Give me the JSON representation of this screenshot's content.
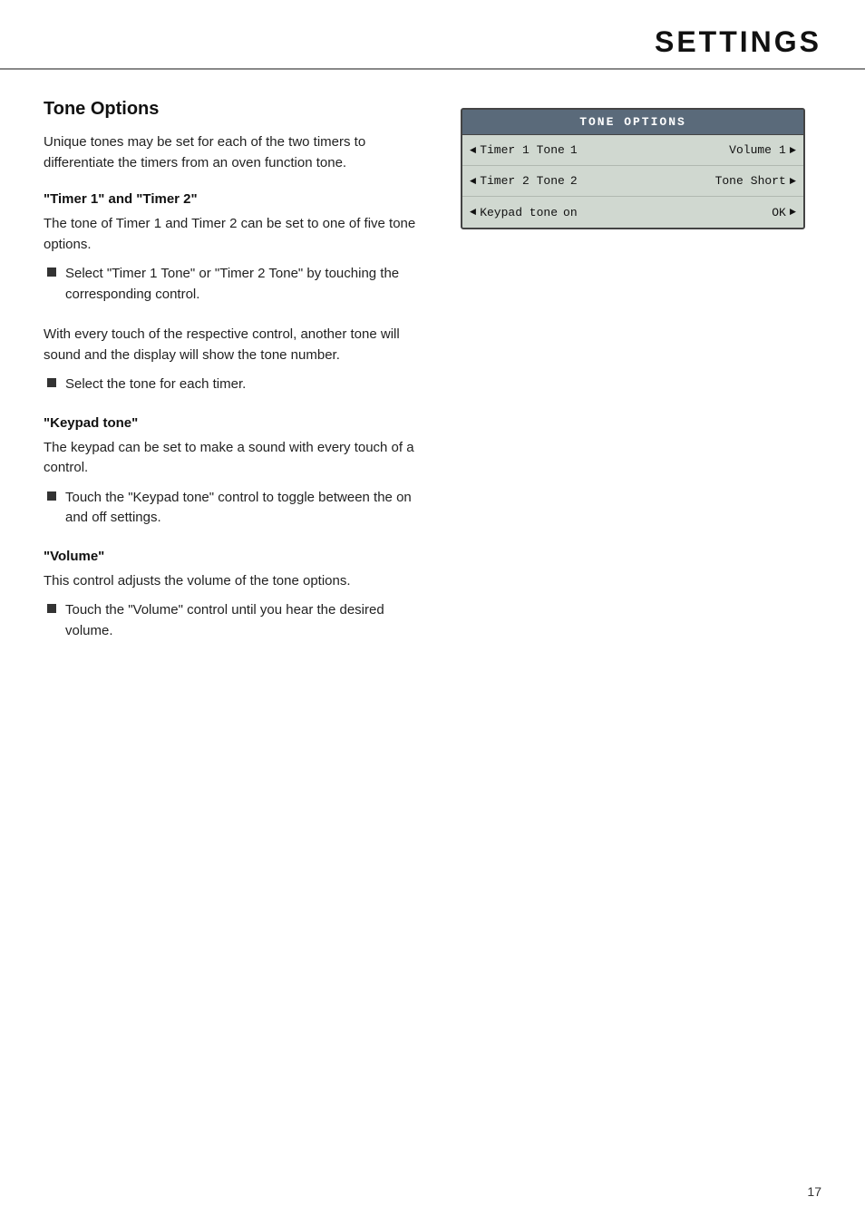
{
  "header": {
    "title": "SETTINGS"
  },
  "page_number": "17",
  "left": {
    "section_title": "Tone Options",
    "intro": "Unique tones may be set for each of the two timers to differentiate the timers from an oven function tone.",
    "subsections": [
      {
        "id": "timer-subsection",
        "title": "\"Timer 1\" and \"Timer 2\"",
        "body": "The tone of Timer 1 and Timer 2 can be set to one of five tone options.",
        "bullets": [
          "Select \"Timer 1 Tone\" or \"Timer 2 Tone\" by touching the corresponding control."
        ]
      },
      {
        "id": "touch-paragraph",
        "title": "",
        "body": "With every touch of the respective control, another tone will sound and the display will show the tone number.",
        "bullets": [
          "Select the tone for each timer."
        ]
      },
      {
        "id": "keypad-subsection",
        "title": "\"Keypad tone\"",
        "body": "The keypad can be set to make a sound with every touch of a control.",
        "bullets": [
          "Touch the \"Keypad tone\" control to toggle between the on and off settings."
        ]
      },
      {
        "id": "volume-subsection",
        "title": "\"Volume\"",
        "body": "This control adjusts the volume of the tone options.",
        "bullets": [
          "Touch the \"Volume\" control until you hear the desired volume."
        ]
      }
    ]
  },
  "display": {
    "header": "TONE OPTIONS",
    "rows": [
      {
        "id": "timer1-row",
        "arrow_left": "◄",
        "label": "Timer 1 Tone",
        "value_label": "1",
        "middle": "Volume",
        "right_value": "1",
        "arrow_right": "►"
      },
      {
        "id": "timer2-row",
        "arrow_left": "◄",
        "label": "Timer 2 Tone",
        "value_label": "2",
        "middle": "Tone",
        "right_value": "Short",
        "arrow_right": "►"
      },
      {
        "id": "keypad-row",
        "arrow_left": "◄",
        "label": "Keypad tone",
        "value_label": "on",
        "middle": "",
        "right_value": "OK",
        "arrow_right": "►"
      }
    ]
  }
}
